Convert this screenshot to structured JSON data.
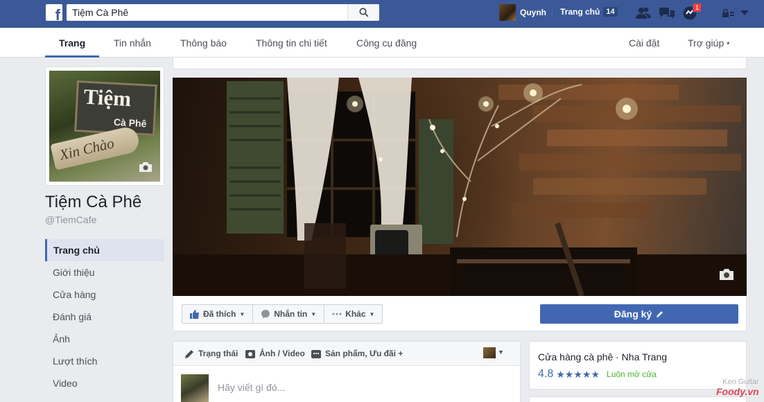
{
  "topbar": {
    "search_value": "Tiệm Cà Phê",
    "user_name": "Quynh",
    "home_label": "Trang chủ",
    "home_count": "14",
    "notifications_count": "1",
    "icons": [
      "facebook-logo-icon",
      "search-icon",
      "friend-requests-icon",
      "messages-icon",
      "notifications-icon",
      "lock-icon",
      "dropdown-icon"
    ]
  },
  "pagenav": {
    "tabs": [
      {
        "label": "Trang"
      },
      {
        "label": "Tin nhắn"
      },
      {
        "label": "Thông báo"
      },
      {
        "label": "Thông tin chi tiết"
      },
      {
        "label": "Công cụ đăng"
      }
    ],
    "settings_label": "Cài đặt",
    "help_label": "Trợ giúp",
    "help_caret": "▾"
  },
  "profile": {
    "sign_line1": "Tiệm",
    "sign_line2": "Cà Phê",
    "sign_line3": "Xin Chào",
    "title": "Tiệm Cà Phê",
    "handle": "@TiemCafe"
  },
  "sidebar": {
    "items": [
      {
        "label": "Trang chủ"
      },
      {
        "label": "Giới thiệu"
      },
      {
        "label": "Cửa hàng"
      },
      {
        "label": "Đánh giá"
      },
      {
        "label": "Ảnh"
      },
      {
        "label": "Lượt thích"
      },
      {
        "label": "Video"
      }
    ]
  },
  "actions": {
    "liked_label": "Đã thích",
    "message_label": "Nhắn tin",
    "more_label": "Khác",
    "subscribe_label": "Đăng ký"
  },
  "composer": {
    "tab_status": "Trạng thái",
    "tab_photo": "Ảnh / Video",
    "tab_products": "Sản phẩm, Ưu đãi +",
    "placeholder": "Hãy viết gì đó..."
  },
  "info": {
    "category": "Cửa hàng cà phê · Nha Trang",
    "rating": "4.8",
    "stars": "★★★★★",
    "open_status": "Luôn mở cửa"
  },
  "watermark": {
    "line1": "Ken Guitar",
    "line2": "Foody.vn"
  },
  "colors": {
    "brand_blue": "#3b5998",
    "button_blue": "#4267b2",
    "open_green": "#42b72a",
    "notification_red": "#fa3e3e"
  }
}
